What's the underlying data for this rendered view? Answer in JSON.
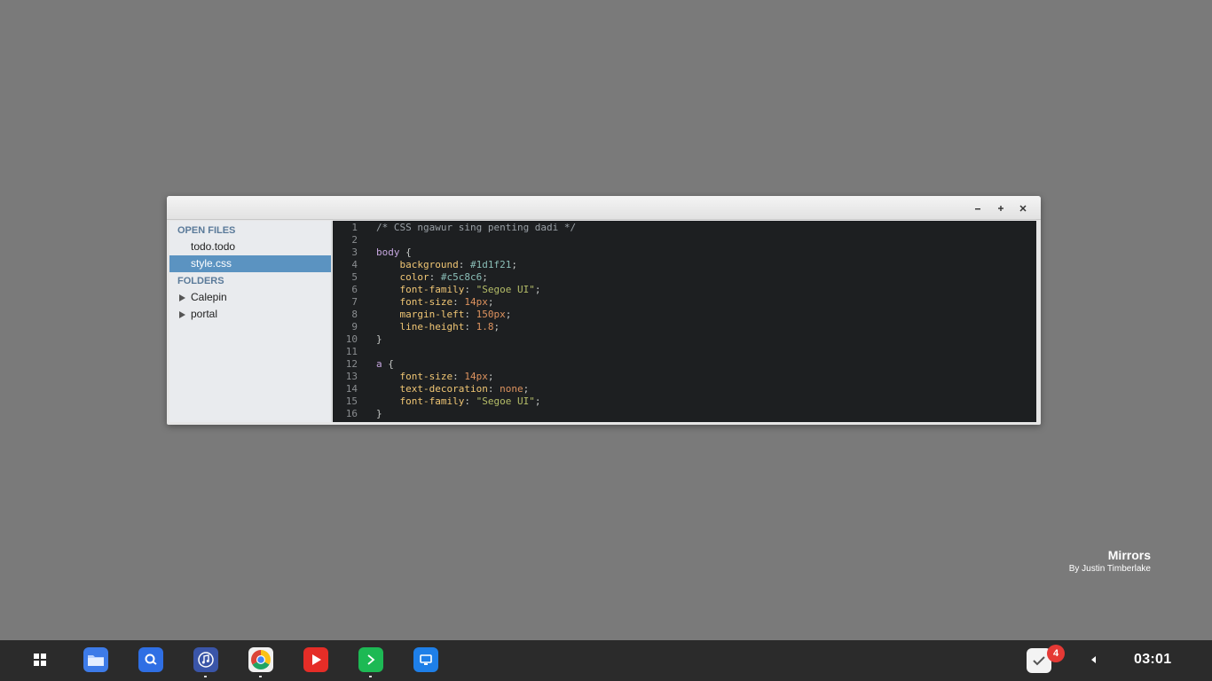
{
  "editor_window": {
    "sidebar": {
      "open_files_header": "OPEN FILES",
      "open_files": [
        {
          "name": "todo.todo",
          "active": false
        },
        {
          "name": "style.css",
          "active": true
        }
      ],
      "folders_header": "FOLDERS",
      "folders": [
        "Calepin",
        "portal"
      ]
    },
    "code_lines": [
      {
        "n": "1",
        "tokens": [
          [
            "comment",
            "/* CSS ngawur sing penting dadi */"
          ]
        ]
      },
      {
        "n": "2",
        "tokens": []
      },
      {
        "n": "3",
        "tokens": [
          [
            "sel",
            "body"
          ],
          [
            "punc",
            " {"
          ]
        ]
      },
      {
        "n": "4",
        "tokens": [
          [
            "punc",
            "    "
          ],
          [
            "prop",
            "background"
          ],
          [
            "punc",
            ": "
          ],
          [
            "hex",
            "#1d1f21"
          ],
          [
            "punc",
            ";"
          ]
        ]
      },
      {
        "n": "5",
        "tokens": [
          [
            "punc",
            "    "
          ],
          [
            "prop",
            "color"
          ],
          [
            "punc",
            ": "
          ],
          [
            "hex",
            "#c5c8c6"
          ],
          [
            "punc",
            ";"
          ]
        ]
      },
      {
        "n": "6",
        "tokens": [
          [
            "punc",
            "    "
          ],
          [
            "prop",
            "font-family"
          ],
          [
            "punc",
            ": "
          ],
          [
            "str",
            "\"Segoe UI\""
          ],
          [
            "punc",
            ";"
          ]
        ]
      },
      {
        "n": "7",
        "tokens": [
          [
            "punc",
            "    "
          ],
          [
            "prop",
            "font-size"
          ],
          [
            "punc",
            ": "
          ],
          [
            "num",
            "14px"
          ],
          [
            "punc",
            ";"
          ]
        ]
      },
      {
        "n": "8",
        "tokens": [
          [
            "punc",
            "    "
          ],
          [
            "prop",
            "margin-left"
          ],
          [
            "punc",
            ": "
          ],
          [
            "num",
            "150px"
          ],
          [
            "punc",
            ";"
          ]
        ]
      },
      {
        "n": "9",
        "tokens": [
          [
            "punc",
            "    "
          ],
          [
            "prop",
            "line-height"
          ],
          [
            "punc",
            ": "
          ],
          [
            "num",
            "1.8"
          ],
          [
            "punc",
            ";"
          ]
        ]
      },
      {
        "n": "10",
        "tokens": [
          [
            "punc",
            "}"
          ]
        ]
      },
      {
        "n": "11",
        "tokens": []
      },
      {
        "n": "12",
        "tokens": [
          [
            "sel",
            "a"
          ],
          [
            "punc",
            " {"
          ]
        ]
      },
      {
        "n": "13",
        "tokens": [
          [
            "punc",
            "    "
          ],
          [
            "prop",
            "font-size"
          ],
          [
            "punc",
            ": "
          ],
          [
            "num",
            "14px"
          ],
          [
            "punc",
            ";"
          ]
        ]
      },
      {
        "n": "14",
        "tokens": [
          [
            "punc",
            "    "
          ],
          [
            "prop",
            "text-decoration"
          ],
          [
            "punc",
            ": "
          ],
          [
            "num",
            "none"
          ],
          [
            "punc",
            ";"
          ]
        ]
      },
      {
        "n": "15",
        "tokens": [
          [
            "punc",
            "    "
          ],
          [
            "prop",
            "font-family"
          ],
          [
            "punc",
            ": "
          ],
          [
            "str",
            "\"Segoe UI\""
          ],
          [
            "punc",
            ";"
          ]
        ]
      },
      {
        "n": "16",
        "tokens": [
          [
            "punc",
            "}"
          ]
        ]
      }
    ]
  },
  "now_playing": {
    "title": "Mirrors",
    "artist": "By Justin Timberlake"
  },
  "taskbar": {
    "apps": [
      {
        "name": "files-app",
        "icon": "folder-icon",
        "color": "#3d7be8"
      },
      {
        "name": "search-app",
        "icon": "search-icon",
        "color": "#2f6fe4"
      },
      {
        "name": "music-app",
        "icon": "music-note-icon",
        "color": "#3a55a8"
      },
      {
        "name": "chrome-app",
        "icon": "chrome-icon",
        "color": "#ffffff"
      },
      {
        "name": "youtube-app",
        "icon": "play-icon",
        "color": "#e52d27"
      },
      {
        "name": "terminal-app",
        "icon": "terminal-prompt-icon",
        "color": "#1db954"
      },
      {
        "name": "remote-app",
        "icon": "screen-icon",
        "color": "#1e7fe8"
      }
    ],
    "notification_count": "4",
    "clock": "03:01"
  }
}
